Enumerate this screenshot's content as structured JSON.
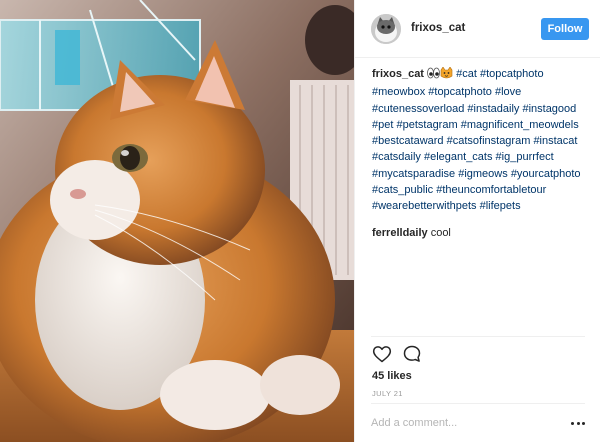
{
  "post": {
    "username": "frixos_cat",
    "follow_label": "Follow",
    "caption": {
      "user": "frixos_cat",
      "emojis": [
        "eyes-emoji",
        "cat-face-emoji"
      ],
      "hashtags": [
        "#cat",
        "#topcatphoto",
        "#meowbox",
        "#topcatphoto",
        "#love",
        "#cutenessoverload",
        "#instadaily",
        "#instagood",
        "#pet",
        "#petstagram",
        "#magnificent_meowdels",
        "#bestcataward",
        "#catsofinstagram",
        "#instacat",
        "#catsdaily",
        "#elegant_cats",
        "#ig_purrfect",
        "#mycatsparadise",
        "#igmeows",
        "#yourcatphoto",
        "#cats_public",
        "#theuncomfortabletour",
        "#wearebetterwithpets",
        "#lifepets"
      ]
    },
    "comments": [
      {
        "user": "ferrelldaily",
        "text": "cool"
      }
    ],
    "likes": "45 likes",
    "date": "JULY 21",
    "comment_placeholder": "Add a comment..."
  },
  "colors": {
    "follow_button": "#3897f0",
    "hashtag": "#003569",
    "text": "#262626",
    "muted": "#999999"
  },
  "icons": [
    "heart-icon",
    "comment-icon",
    "more-options-icon"
  ]
}
